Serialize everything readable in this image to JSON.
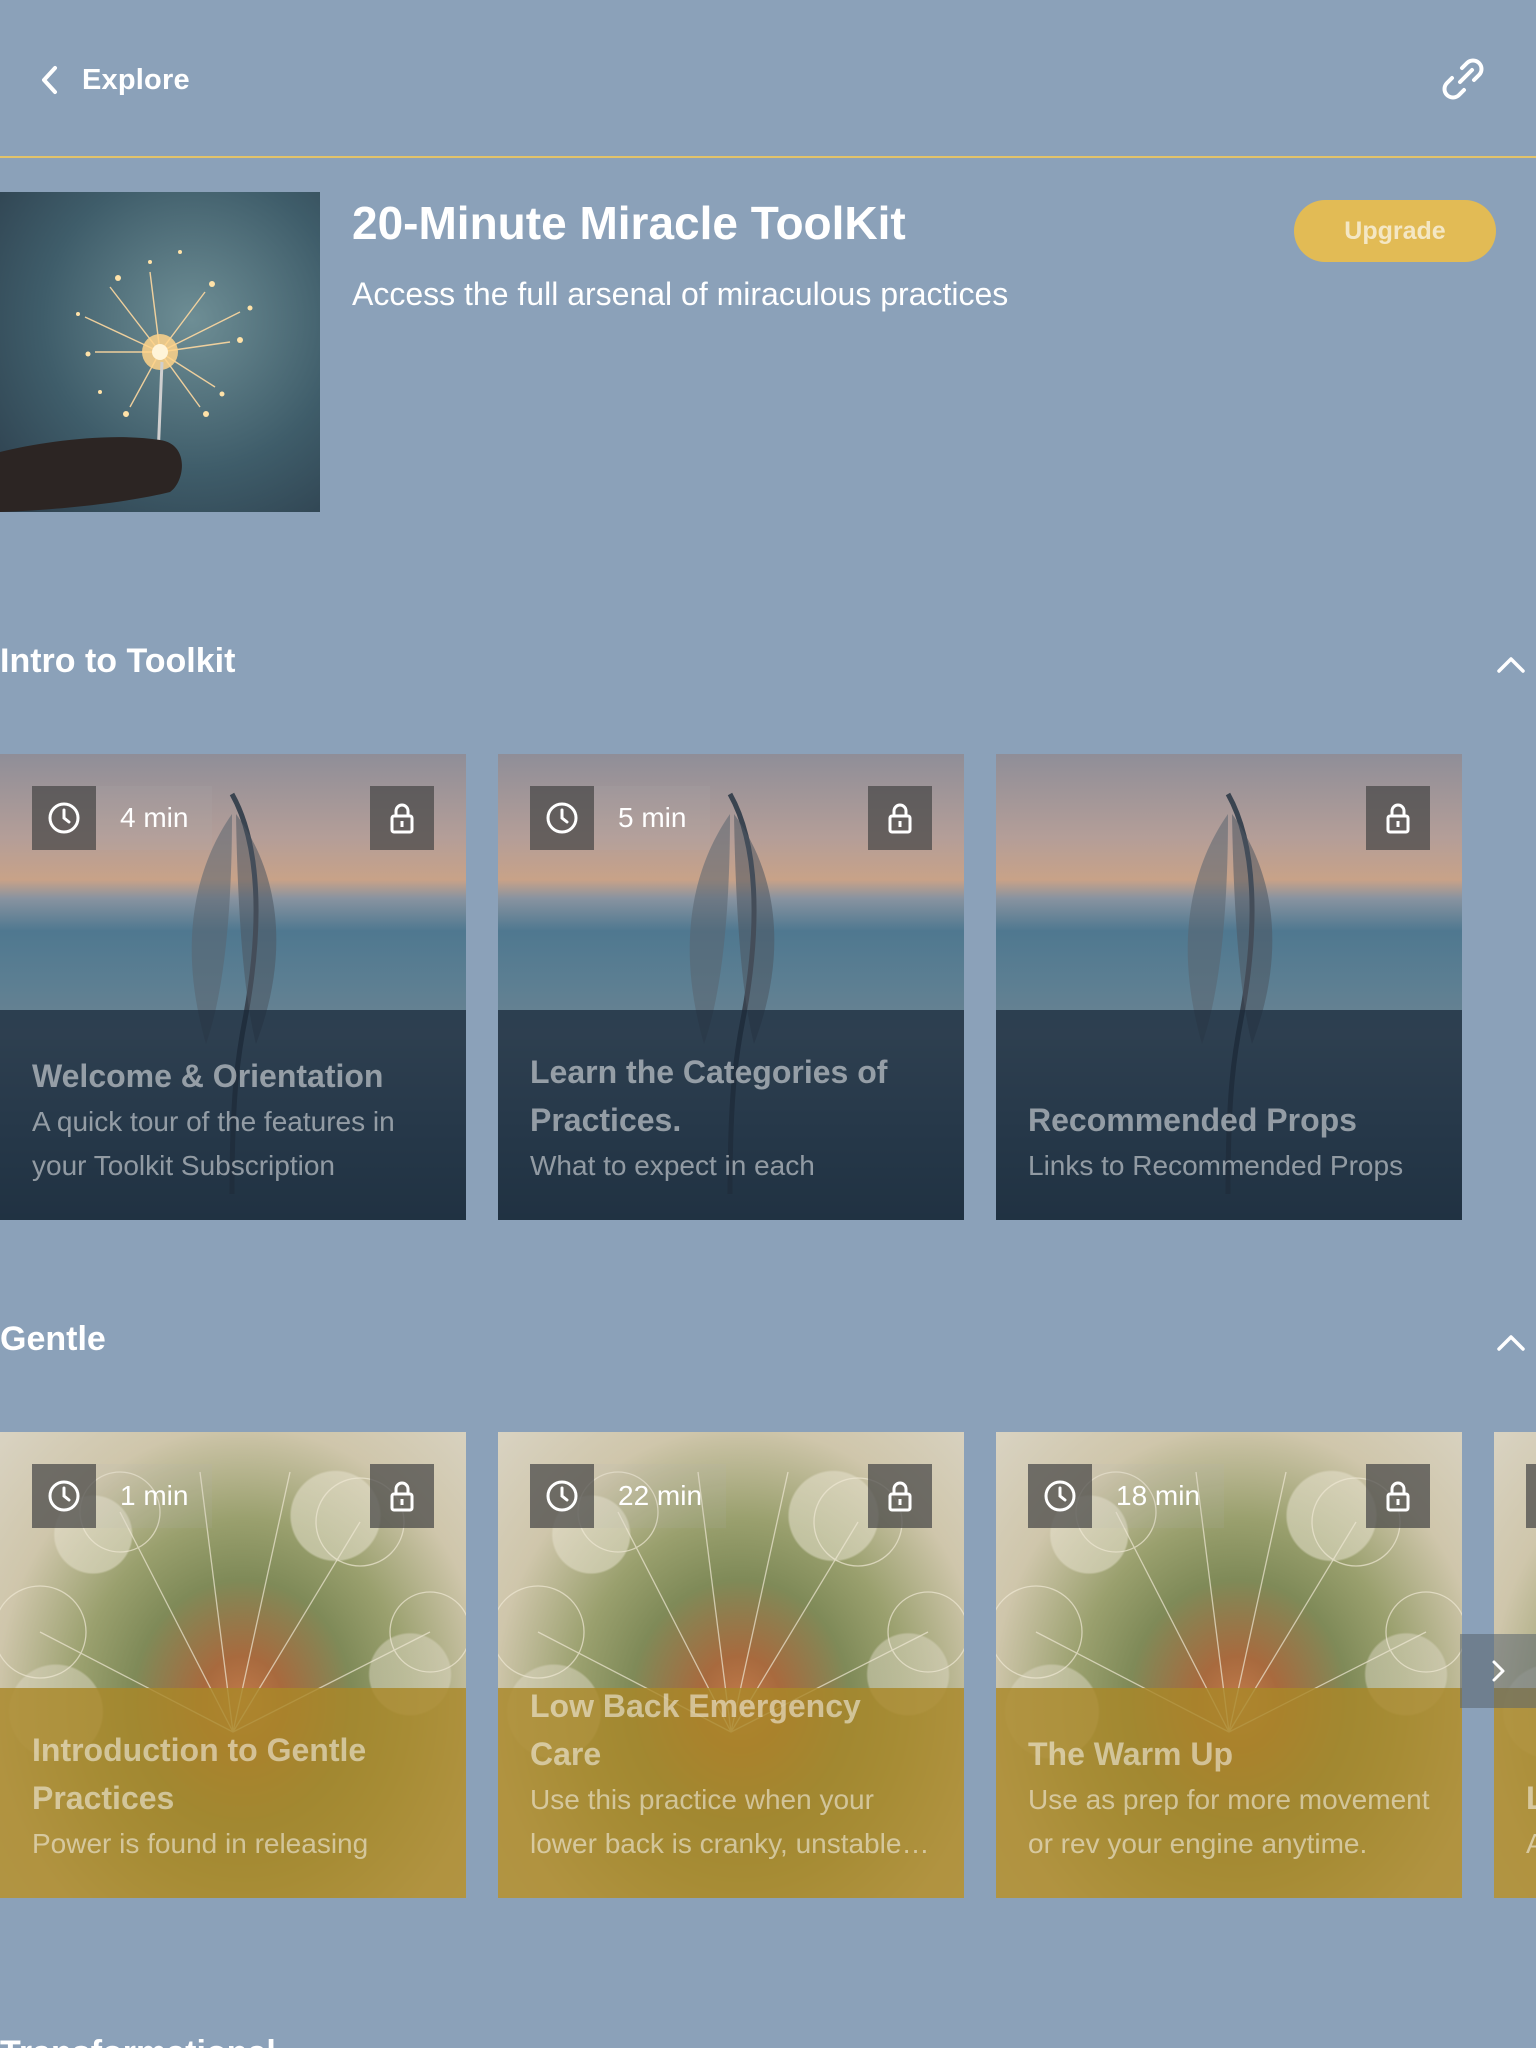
{
  "header": {
    "back_label": "Explore"
  },
  "hero": {
    "title": "20-Minute Miracle ToolKit",
    "subtitle": "Access the full arsenal of miraculous practices",
    "upgrade_label": "Upgrade"
  },
  "sections": [
    {
      "title": "Intro to Toolkit",
      "cards": [
        {
          "duration": "4 min",
          "title": "Welcome & Orientation",
          "description": "A quick tour of the features in your Toolkit Subscription"
        },
        {
          "duration": "5 min",
          "title": "Learn the Categories of Practices.",
          "description": "What to expect in each"
        },
        {
          "duration": "",
          "title": "Recommended Props",
          "description": "Links to Recommended Props"
        }
      ]
    },
    {
      "title": "Gentle",
      "cards": [
        {
          "duration": "1 min",
          "title": "Introduction to Gentle Practices",
          "description": "Power is found in releasing"
        },
        {
          "duration": "22 min",
          "title": "Low Back Emergency Care",
          "description": "Use this practice when your lower back is cranky, unstable or in pain."
        },
        {
          "duration": "18 min",
          "title": "The Warm Up",
          "description": "Use as prep for more movement or rev your engine anytime."
        },
        {
          "duration": "",
          "title": "L",
          "description": "A l"
        }
      ]
    },
    {
      "title": "Transformational"
    }
  ],
  "icons": {
    "back": "chevron-left-icon",
    "share": "link-icon",
    "collapse": "chevron-up-icon",
    "duration": "clock-icon",
    "locked": "lock-icon",
    "next": "chevron-right-icon"
  },
  "colors": {
    "background": "#8ba1b9",
    "accent": "#e2bb55",
    "divider": "#e2c36a"
  }
}
